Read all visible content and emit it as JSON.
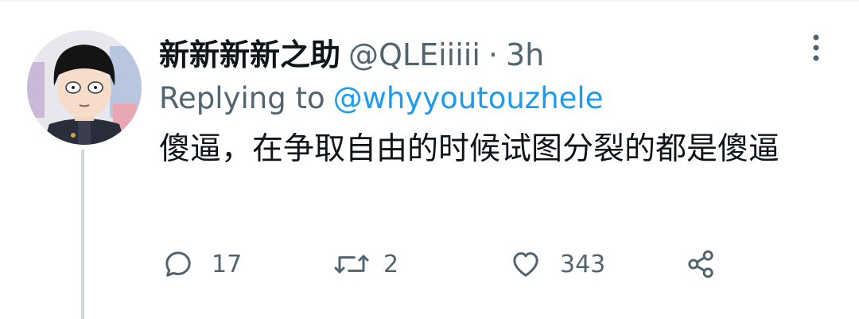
{
  "tweet": {
    "display_name": "新新新新之助",
    "handle": "@QLEiiiii",
    "separator": "·",
    "timestamp": "3h",
    "replying_label": "Replying to",
    "replying_to": "@whyyoutouzhele",
    "text": "傻逼，在争取自由的时候试图分裂的都是傻逼"
  },
  "actions": {
    "reply_count": "17",
    "retweet_count": "2",
    "like_count": "343"
  },
  "icons": {
    "reply": "reply-icon",
    "retweet": "retweet-icon",
    "like": "heart-icon",
    "share": "share-icon",
    "more": "more-vertical-icon"
  },
  "colors": {
    "accent": "#1d9bf0",
    "muted": "#536471",
    "text": "#0f1419",
    "thread_line": "#cfd9de"
  }
}
